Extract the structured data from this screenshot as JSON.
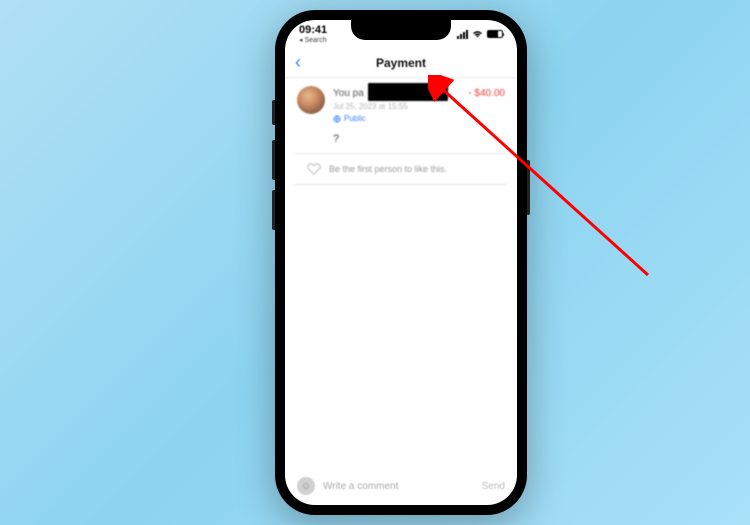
{
  "status": {
    "time": "09:41",
    "back_app": "◂ Search"
  },
  "header": {
    "title": "Payment"
  },
  "payment": {
    "prefix": "You pa",
    "amount": "- $40.00",
    "date": "Jul 25, 2023 at 15:55",
    "visibility": "Public",
    "note": "?"
  },
  "like": {
    "prompt": "Be the first person to like this."
  },
  "composer": {
    "placeholder": "Write a comment",
    "send": "Send"
  }
}
